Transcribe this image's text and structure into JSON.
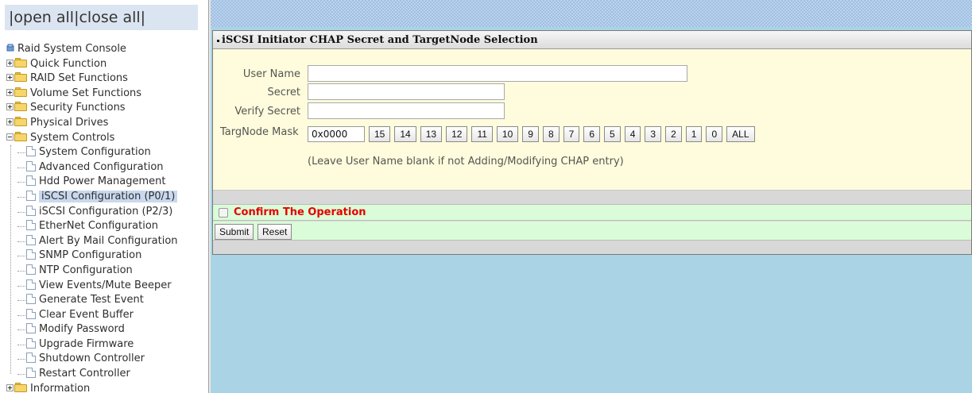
{
  "nav": {
    "open_all": "open all",
    "close_all": "close all",
    "separator": "|",
    "root_label": "Raid System Console",
    "groups": [
      {
        "label": "Quick Function",
        "expanded": false
      },
      {
        "label": "RAID Set Functions",
        "expanded": false
      },
      {
        "label": "Volume Set Functions",
        "expanded": false
      },
      {
        "label": "Security Functions",
        "expanded": false
      },
      {
        "label": "Physical Drives",
        "expanded": false
      },
      {
        "label": "System Controls",
        "expanded": true
      },
      {
        "label": "Information",
        "expanded": false
      }
    ],
    "system_controls_items": [
      "System Configuration",
      "Advanced Configuration",
      "Hdd Power Management",
      "iSCSI Configuration (P0/1)",
      "iSCSI Configuration (P2/3)",
      "EtherNet Configuration",
      "Alert By Mail Configuration",
      "SNMP Configuration",
      "NTP Configuration",
      "View Events/Mute Beeper",
      "Generate Test Event",
      "Clear Event Buffer",
      "Modify Password",
      "Upgrade Firmware",
      "Shutdown Controller",
      "Restart Controller"
    ],
    "selected_item": "iSCSI Configuration (P0/1)"
  },
  "panel": {
    "title": "iSCSI Initiator CHAP Secret and TargetNode Selection",
    "fields": {
      "user_name_label": "User Name",
      "user_name_value": "",
      "secret_label": "Secret",
      "secret_value": "",
      "verify_secret_label": "Verify Secret",
      "verify_secret_value": "",
      "targnode_mask_label": "TargNode Mask",
      "targnode_mask_value": "0x0000"
    },
    "bit_buttons": [
      "15",
      "14",
      "13",
      "12",
      "11",
      "10",
      "9",
      "8",
      "7",
      "6",
      "5",
      "4",
      "3",
      "2",
      "1",
      "0",
      "ALL"
    ],
    "note": "(Leave User Name blank if not Adding/Modifying CHAP entry)",
    "confirm_label": "Confirm The Operation",
    "confirm_checked": false,
    "submit_label": "Submit",
    "reset_label": "Reset"
  },
  "colors": {
    "form_background": "#fefcdc",
    "confirm_background": "#dafcd8",
    "confirm_text": "#e60000",
    "content_background": "#aad3e6",
    "nav_header_background": "#dbe5f1",
    "selected_item_background": "#c9d8ee"
  }
}
